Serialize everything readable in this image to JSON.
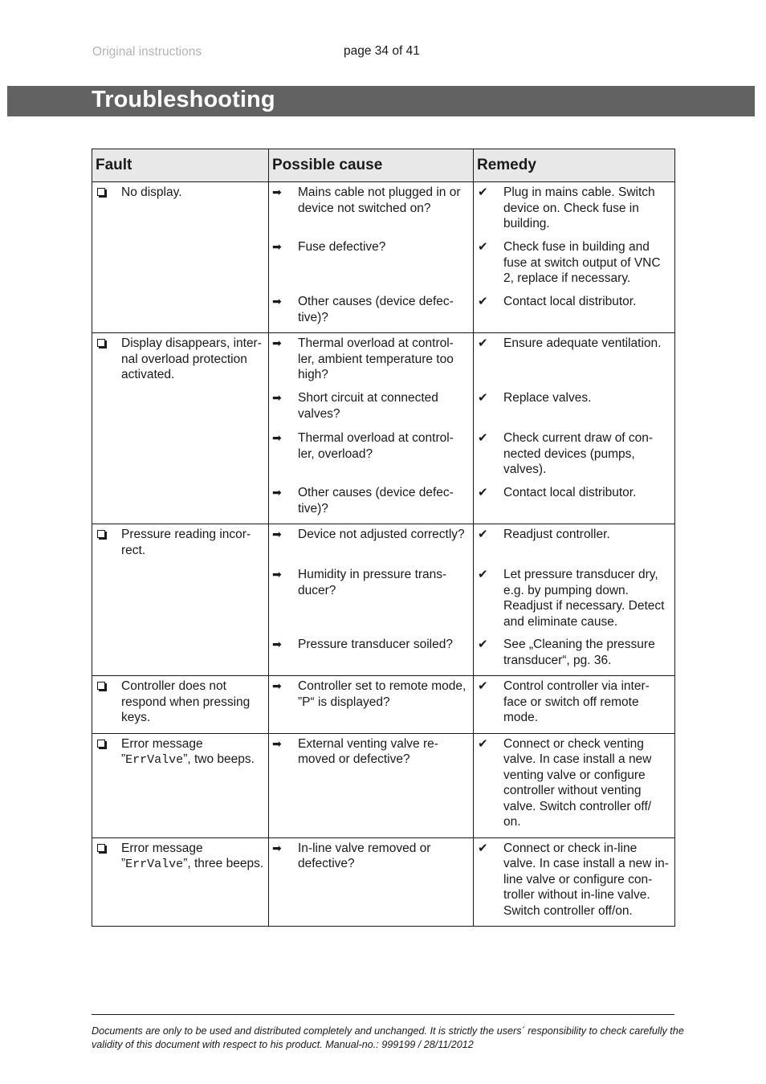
{
  "header": {
    "left_label": "Original instructions",
    "page_indicator": "page 34 of 41"
  },
  "title": "Troubleshooting",
  "table": {
    "columns": [
      "Fault",
      "Possible cause",
      "Remedy"
    ],
    "icons": {
      "fault": "checkbox-icon",
      "cause": "arrow-right-icon",
      "remedy": "checkmark-icon"
    },
    "rows": [
      {
        "fault": "No display.",
        "pairs": [
          {
            "cause": "Mains cable not plugged in or device not switched on?",
            "remedy": "Plug in mains cable. Switch device on. Check fuse in building."
          },
          {
            "cause": "Fuse defective?",
            "remedy": "Check fuse in building and fuse at switch output of VNC 2, replace if necessary."
          },
          {
            "cause": "Other causes (device defec-tive)?",
            "remedy": "Contact local distributor."
          }
        ]
      },
      {
        "fault": "Display disappears, inter-nal overload protection activated.",
        "pairs": [
          {
            "cause": "Thermal overload at control-ler, ambient temperature too high?",
            "remedy": "Ensure adequate ventilation."
          },
          {
            "cause": "Short circuit at connected valves?",
            "remedy": "Replace valves."
          },
          {
            "cause": "Thermal overload at control-ler, overload?",
            "remedy": "Check current draw of con-nected devices (pumps, valves)."
          },
          {
            "cause": "Other causes (device defec-tive)?",
            "remedy": "Contact local distributor."
          }
        ]
      },
      {
        "fault": "Pressure reading incor-rect.",
        "pairs": [
          {
            "cause": "Device not adjusted correctly?",
            "remedy": "Readjust controller."
          },
          {
            "cause": "Humidity in pressure trans-ducer?",
            "remedy": "Let pressure transducer dry, e.g. by pumping down. Readjust if necessary. Detect and eliminate cause."
          },
          {
            "cause": "Pressure transducer soiled?",
            "remedy": "See „Cleaning the pressure transducer“, pg. 36."
          }
        ]
      },
      {
        "fault": "Controller does not respond when pressing keys.",
        "pairs": [
          {
            "cause": "Controller set to remote mode, ”P“ is  displayed?",
            "remedy": "Control controller via inter-face or switch off remote mode."
          }
        ]
      },
      {
        "fault_prefix": "Error message ”",
        "fault_code": "ErrValve",
        "fault_suffix": "”, two beeps.",
        "pairs": [
          {
            "cause": "External venting valve re-moved or defective?",
            "remedy": "Connect or check venting valve. In case install a new venting valve or configure controller without venting valve. Switch controller off/ on."
          }
        ]
      },
      {
        "fault_prefix": "Error message ”",
        "fault_code": "ErrValve",
        "fault_suffix": "”, three beeps.",
        "pairs": [
          {
            "cause": "In-line valve removed or defective?",
            "remedy": "Connect or check in-line valve. In case install a new in-line valve or configure con-troller without in-line valve. Switch controller off/on."
          }
        ]
      }
    ]
  },
  "footer": {
    "disclaimer": "Documents are only to be used and distributed completely and unchanged. It is strictly the users´ responsibility to check carefully the validity of this document with respect to his product. Manual-no.: 999199 / 28/11/2012"
  }
}
